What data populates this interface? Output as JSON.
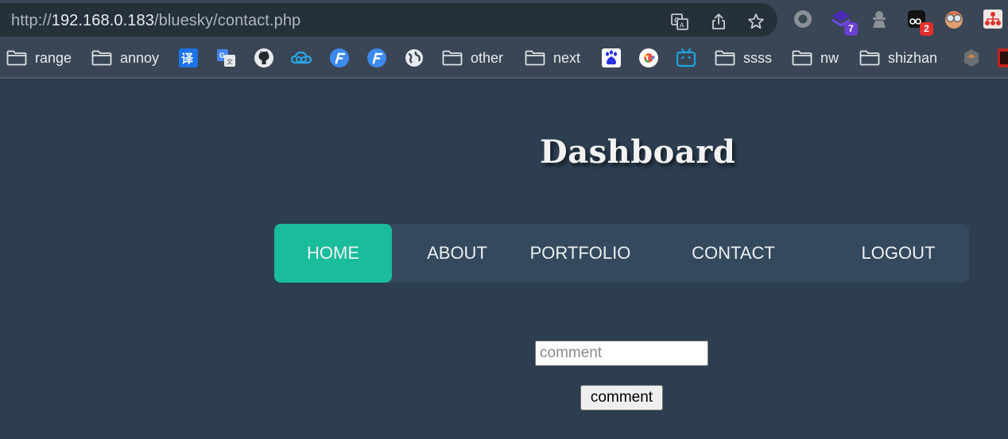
{
  "browser": {
    "url_scheme": "http://",
    "url_host": "192.168.0.183",
    "url_path": "/bluesky/contact.php",
    "extension_badges": {
      "purple": "7",
      "red": "2"
    },
    "bookmarks": [
      {
        "label": "range",
        "icon": "folder-icon"
      },
      {
        "label": "annoy",
        "icon": "folder-icon"
      },
      {
        "label": "",
        "icon": "translate-cn-icon"
      },
      {
        "label": "",
        "icon": "google-translate-icon"
      },
      {
        "label": "",
        "icon": "github-icon"
      },
      {
        "label": "",
        "icon": "cloud-icon"
      },
      {
        "label": "",
        "icon": "f-app-icon"
      },
      {
        "label": "",
        "icon": "f-app-icon"
      },
      {
        "label": "",
        "icon": "globe-icon"
      },
      {
        "label": "other",
        "icon": "folder-icon"
      },
      {
        "label": "next",
        "icon": "folder-icon"
      },
      {
        "label": "",
        "icon": "baidu-icon"
      },
      {
        "label": "",
        "icon": "google-icon"
      },
      {
        "label": "",
        "icon": "bilibili-icon"
      },
      {
        "label": "ssss",
        "icon": "folder-icon"
      },
      {
        "label": "nw",
        "icon": "folder-icon"
      },
      {
        "label": "shizhan",
        "icon": "folder-icon"
      }
    ]
  },
  "page": {
    "title": "Dashboard",
    "nav": {
      "home": "HOME",
      "about": "ABOUT",
      "portfolio": "PORTFOLIO",
      "contact": "CONTACT",
      "logout": "LOGOUT"
    },
    "form": {
      "input_placeholder": "comment",
      "button_label": "comment"
    }
  },
  "colors": {
    "page_bg": "#2c3e50",
    "nav_bg": "#34495e",
    "nav_active": "#1abc9c"
  }
}
